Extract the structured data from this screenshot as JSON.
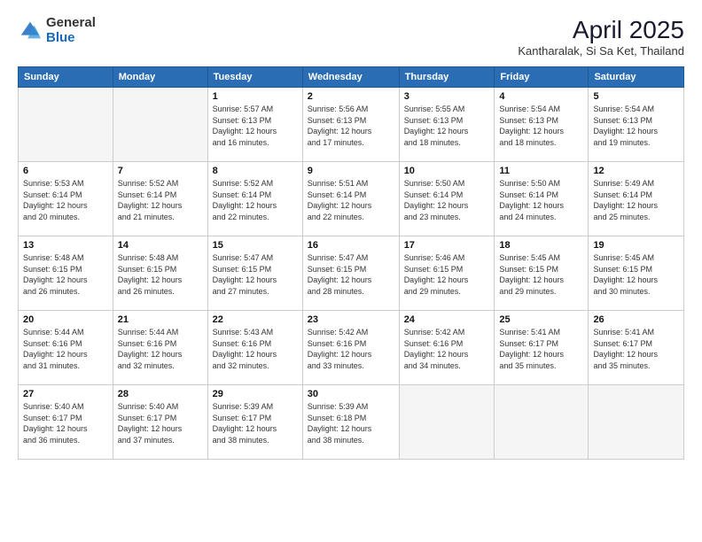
{
  "logo": {
    "general": "General",
    "blue": "Blue"
  },
  "header": {
    "title": "April 2025",
    "subtitle": "Kantharalak, Si Sa Ket, Thailand"
  },
  "weekdays": [
    "Sunday",
    "Monday",
    "Tuesday",
    "Wednesday",
    "Thursday",
    "Friday",
    "Saturday"
  ],
  "weeks": [
    [
      {
        "day": "",
        "detail": ""
      },
      {
        "day": "",
        "detail": ""
      },
      {
        "day": "1",
        "detail": "Sunrise: 5:57 AM\nSunset: 6:13 PM\nDaylight: 12 hours\nand 16 minutes."
      },
      {
        "day": "2",
        "detail": "Sunrise: 5:56 AM\nSunset: 6:13 PM\nDaylight: 12 hours\nand 17 minutes."
      },
      {
        "day": "3",
        "detail": "Sunrise: 5:55 AM\nSunset: 6:13 PM\nDaylight: 12 hours\nand 18 minutes."
      },
      {
        "day": "4",
        "detail": "Sunrise: 5:54 AM\nSunset: 6:13 PM\nDaylight: 12 hours\nand 18 minutes."
      },
      {
        "day": "5",
        "detail": "Sunrise: 5:54 AM\nSunset: 6:13 PM\nDaylight: 12 hours\nand 19 minutes."
      }
    ],
    [
      {
        "day": "6",
        "detail": "Sunrise: 5:53 AM\nSunset: 6:14 PM\nDaylight: 12 hours\nand 20 minutes."
      },
      {
        "day": "7",
        "detail": "Sunrise: 5:52 AM\nSunset: 6:14 PM\nDaylight: 12 hours\nand 21 minutes."
      },
      {
        "day": "8",
        "detail": "Sunrise: 5:52 AM\nSunset: 6:14 PM\nDaylight: 12 hours\nand 22 minutes."
      },
      {
        "day": "9",
        "detail": "Sunrise: 5:51 AM\nSunset: 6:14 PM\nDaylight: 12 hours\nand 22 minutes."
      },
      {
        "day": "10",
        "detail": "Sunrise: 5:50 AM\nSunset: 6:14 PM\nDaylight: 12 hours\nand 23 minutes."
      },
      {
        "day": "11",
        "detail": "Sunrise: 5:50 AM\nSunset: 6:14 PM\nDaylight: 12 hours\nand 24 minutes."
      },
      {
        "day": "12",
        "detail": "Sunrise: 5:49 AM\nSunset: 6:14 PM\nDaylight: 12 hours\nand 25 minutes."
      }
    ],
    [
      {
        "day": "13",
        "detail": "Sunrise: 5:48 AM\nSunset: 6:15 PM\nDaylight: 12 hours\nand 26 minutes."
      },
      {
        "day": "14",
        "detail": "Sunrise: 5:48 AM\nSunset: 6:15 PM\nDaylight: 12 hours\nand 26 minutes."
      },
      {
        "day": "15",
        "detail": "Sunrise: 5:47 AM\nSunset: 6:15 PM\nDaylight: 12 hours\nand 27 minutes."
      },
      {
        "day": "16",
        "detail": "Sunrise: 5:47 AM\nSunset: 6:15 PM\nDaylight: 12 hours\nand 28 minutes."
      },
      {
        "day": "17",
        "detail": "Sunrise: 5:46 AM\nSunset: 6:15 PM\nDaylight: 12 hours\nand 29 minutes."
      },
      {
        "day": "18",
        "detail": "Sunrise: 5:45 AM\nSunset: 6:15 PM\nDaylight: 12 hours\nand 29 minutes."
      },
      {
        "day": "19",
        "detail": "Sunrise: 5:45 AM\nSunset: 6:15 PM\nDaylight: 12 hours\nand 30 minutes."
      }
    ],
    [
      {
        "day": "20",
        "detail": "Sunrise: 5:44 AM\nSunset: 6:16 PM\nDaylight: 12 hours\nand 31 minutes."
      },
      {
        "day": "21",
        "detail": "Sunrise: 5:44 AM\nSunset: 6:16 PM\nDaylight: 12 hours\nand 32 minutes."
      },
      {
        "day": "22",
        "detail": "Sunrise: 5:43 AM\nSunset: 6:16 PM\nDaylight: 12 hours\nand 32 minutes."
      },
      {
        "day": "23",
        "detail": "Sunrise: 5:42 AM\nSunset: 6:16 PM\nDaylight: 12 hours\nand 33 minutes."
      },
      {
        "day": "24",
        "detail": "Sunrise: 5:42 AM\nSunset: 6:16 PM\nDaylight: 12 hours\nand 34 minutes."
      },
      {
        "day": "25",
        "detail": "Sunrise: 5:41 AM\nSunset: 6:17 PM\nDaylight: 12 hours\nand 35 minutes."
      },
      {
        "day": "26",
        "detail": "Sunrise: 5:41 AM\nSunset: 6:17 PM\nDaylight: 12 hours\nand 35 minutes."
      }
    ],
    [
      {
        "day": "27",
        "detail": "Sunrise: 5:40 AM\nSunset: 6:17 PM\nDaylight: 12 hours\nand 36 minutes."
      },
      {
        "day": "28",
        "detail": "Sunrise: 5:40 AM\nSunset: 6:17 PM\nDaylight: 12 hours\nand 37 minutes."
      },
      {
        "day": "29",
        "detail": "Sunrise: 5:39 AM\nSunset: 6:17 PM\nDaylight: 12 hours\nand 38 minutes."
      },
      {
        "day": "30",
        "detail": "Sunrise: 5:39 AM\nSunset: 6:18 PM\nDaylight: 12 hours\nand 38 minutes."
      },
      {
        "day": "",
        "detail": ""
      },
      {
        "day": "",
        "detail": ""
      },
      {
        "day": "",
        "detail": ""
      }
    ]
  ]
}
